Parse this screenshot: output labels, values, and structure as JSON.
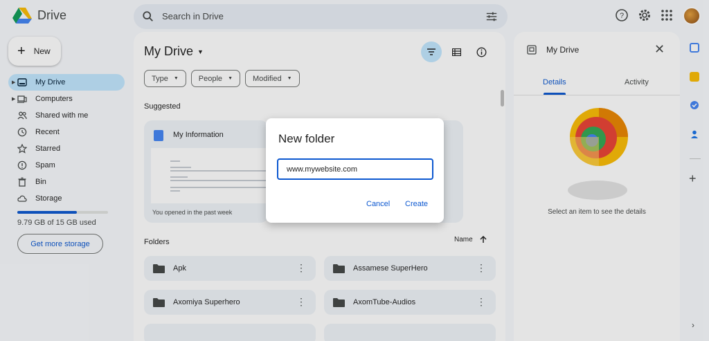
{
  "app": {
    "name": "Drive"
  },
  "search": {
    "placeholder": "Search in Drive"
  },
  "header_icons": [
    "help-icon",
    "settings-icon",
    "apps-grid-icon",
    "account-avatar"
  ],
  "new_button": {
    "label": "New"
  },
  "nav": {
    "items": [
      {
        "label": "My Drive",
        "icon": "my-drive-icon",
        "active": true,
        "expandable": true
      },
      {
        "label": "Computers",
        "icon": "computers-icon",
        "expandable": true
      },
      {
        "label": "Shared with me",
        "icon": "shared-icon"
      },
      {
        "label": "Recent",
        "icon": "recent-clock-icon"
      },
      {
        "label": "Starred",
        "icon": "star-icon"
      },
      {
        "label": "Spam",
        "icon": "spam-icon"
      },
      {
        "label": "Bin",
        "icon": "bin-icon"
      },
      {
        "label": "Storage",
        "icon": "cloud-icon"
      }
    ]
  },
  "storage": {
    "used_text": "9.79 GB of 15 GB used",
    "fraction_used": 0.653,
    "button": "Get more storage"
  },
  "main": {
    "title": "My Drive",
    "filters": [
      "Type",
      "People",
      "Modified"
    ],
    "suggested_label": "Suggested",
    "suggested": [
      {
        "title": "My Information",
        "subtitle": "You opened in the past week"
      }
    ],
    "folders_label": "Folders",
    "sort_label": "Name",
    "folders": [
      {
        "name": "Apk"
      },
      {
        "name": "Assamese SuperHero"
      },
      {
        "name": "Axomiya Superhero"
      },
      {
        "name": "AxomTube-Audios"
      }
    ]
  },
  "details_panel": {
    "title": "My Drive",
    "tabs": [
      "Details",
      "Activity"
    ],
    "active_tab": "Details",
    "empty_text": "Select an item to see the details"
  },
  "side_apps": [
    "calendar-icon",
    "keep-icon",
    "tasks-icon",
    "contacts-icon"
  ],
  "dialog": {
    "title": "New folder",
    "input_value": "www.mywebsite.com",
    "cancel": "Cancel",
    "create": "Create"
  },
  "colors": {
    "accent": "#0b57d0",
    "active_nav": "#c2e7ff",
    "card_bg": "#f0f4f9",
    "page_bg": "#f8fafd"
  }
}
